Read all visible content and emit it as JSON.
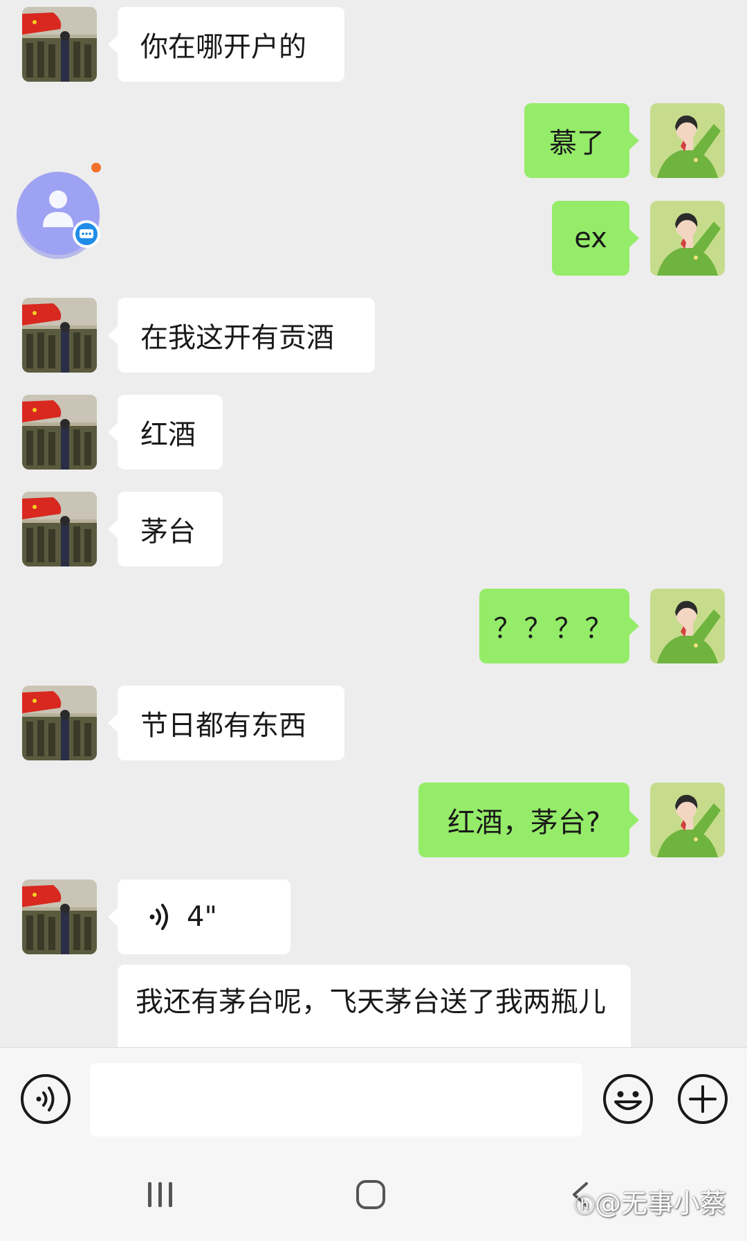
{
  "messages": [
    {
      "side": "left",
      "type": "text",
      "text": "你在哪开户的"
    },
    {
      "side": "right",
      "type": "text",
      "text": "慕了"
    },
    {
      "side": "right",
      "type": "text",
      "text": "ex"
    },
    {
      "side": "left",
      "type": "text",
      "text": "在我这开有贡酒"
    },
    {
      "side": "left",
      "type": "text",
      "text": "红酒"
    },
    {
      "side": "left",
      "type": "text",
      "text": "茅台"
    },
    {
      "side": "right",
      "type": "text",
      "text": "？？？？"
    },
    {
      "side": "left",
      "type": "text",
      "text": "节日都有东西"
    },
    {
      "side": "right",
      "type": "text",
      "text": "红酒，茅台?"
    },
    {
      "side": "left",
      "type": "voice",
      "text": "4\""
    },
    {
      "side": "left",
      "type": "text",
      "text": "我还有茅台呢，飞天茅台送了我两瓶儿"
    }
  ],
  "input_bar": {
    "voice_button": "voice-icon",
    "input_placeholder": "",
    "emoji_button": "emoji-icon",
    "more_button": "plus-icon"
  },
  "nav_bar": [
    "recent-apps-icon",
    "home-icon",
    "back-icon"
  ],
  "watermark": "@无事小蔡",
  "colors": {
    "background": "#ededed",
    "incoming_bubble": "#ffffff",
    "outgoing_bubble": "#95ec69",
    "input_bar": "#f6f6f6"
  }
}
